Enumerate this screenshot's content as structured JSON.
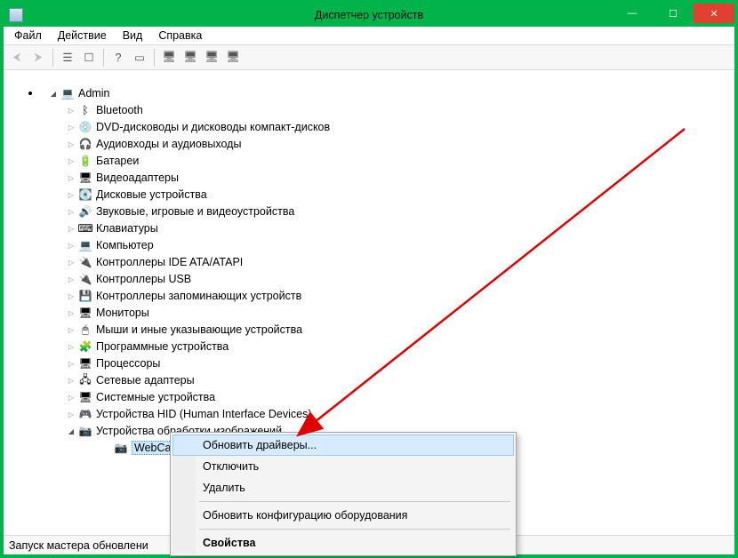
{
  "window": {
    "title": "Диспетчер устройств"
  },
  "menu": {
    "file": "Файл",
    "action": "Действие",
    "view": "Вид",
    "help": "Справка"
  },
  "tree": {
    "root": "Admin",
    "items": [
      "Bluetooth",
      "DVD-дисководы и дисководы компакт-дисков",
      "Аудиовходы и аудиовыходы",
      "Батареи",
      "Видеоадаптеры",
      "Дисковые устройства",
      "Звуковые, игровые и видеоустройства",
      "Клавиатуры",
      "Компьютер",
      "Контроллеры IDE ATA/ATAPI",
      "Контроллеры USB",
      "Контроллеры запоминающих устройств",
      "Мониторы",
      "Мыши и иные указывающие устройства",
      "Программные устройства",
      "Процессоры",
      "Сетевые адаптеры",
      "Системные устройства",
      "Устройства HID (Human Interface Devices)",
      "Устройства обработки изображений"
    ],
    "expanded_item": "Устройства обработки изображений",
    "selected_child": "WebCam SC"
  },
  "context_menu": {
    "update_drivers": "Обновить драйверы...",
    "disable": "Отключить",
    "remove": "Удалить",
    "scan": "Обновить конфигурацию оборудования",
    "properties": "Свойства"
  },
  "statusbar": {
    "text": "Запуск мастера обновлени"
  },
  "icons": {
    "root": "💻",
    "list": [
      "ᛒ",
      "💿",
      "🎧",
      "🔋",
      "🖥",
      "💽",
      "🔊",
      "⌨",
      "💻",
      "🔌",
      "🔌",
      "💾",
      "🖥",
      "🖱",
      "🧩",
      "🖥",
      "🖧",
      "🖥",
      "🎮",
      "📷"
    ],
    "child": "📷"
  }
}
